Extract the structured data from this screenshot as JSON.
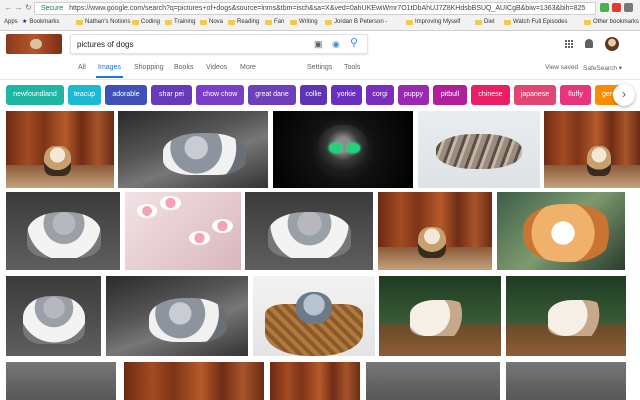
{
  "browser": {
    "url": "https://www.google.com/search?q=pictures+of+dogs&source=lnms&tbm=isch&sa=X&ved=0ahUKEwiWmr7O1tDbAhUJ7Z8KHdsbBSUQ_AUICgB&biw=1363&bih=825",
    "secure_label": "Secure",
    "bookmarks": [
      {
        "label": "Apps"
      },
      {
        "label": "Bookmarks"
      },
      {
        "label": "Nathan's Notions"
      },
      {
        "label": "Coding"
      },
      {
        "label": "Training"
      },
      {
        "label": "Nova"
      },
      {
        "label": "Reading"
      },
      {
        "label": "Fan"
      },
      {
        "label": "Writing"
      },
      {
        "label": "Jordan B Peterson -"
      },
      {
        "label": "Improving Myself"
      },
      {
        "label": "Diet"
      },
      {
        "label": "Watch Full Episodes"
      },
      {
        "label": "Other bookmarks"
      }
    ]
  },
  "search": {
    "query": "pictures of dogs",
    "tabs": [
      "All",
      "Images",
      "Shopping",
      "Books",
      "Videos",
      "More"
    ],
    "active_tab": "Images",
    "settings_label": "Settings",
    "tools_label": "Tools",
    "view_saved_label": "View saved",
    "safesearch_label": "SafeSearch"
  },
  "chips": [
    {
      "label": "newfoundland",
      "color": "#1db5a3"
    },
    {
      "label": "teacup",
      "color": "#1bbad4"
    },
    {
      "label": "adorable",
      "color": "#3f51b5"
    },
    {
      "label": "shar pei",
      "color": "#673ab7"
    },
    {
      "label": "chow chow",
      "color": "#7b3fc7"
    },
    {
      "label": "great dane",
      "color": "#6d3fb8"
    },
    {
      "label": "collie",
      "color": "#5e35b1"
    },
    {
      "label": "yorkie",
      "color": "#6a2fbf"
    },
    {
      "label": "corgi",
      "color": "#7a2db9"
    },
    {
      "label": "puppy",
      "color": "#9c27b0"
    },
    {
      "label": "pitbull",
      "color": "#b01e9c"
    },
    {
      "label": "chinese",
      "color": "#e91e63"
    },
    {
      "label": "japanese",
      "color": "#e24574"
    },
    {
      "label": "fluffy",
      "color": "#e8347a"
    },
    {
      "label": "germ",
      "color": "#fb8c00"
    }
  ],
  "icons": {
    "camera": "camera-icon",
    "mic": "microphone-icon",
    "search": "search-icon",
    "apps": "apps-grid-icon",
    "notifications": "bell-icon",
    "avatar": "avatar",
    "chevron": "chevron-right-icon"
  }
}
